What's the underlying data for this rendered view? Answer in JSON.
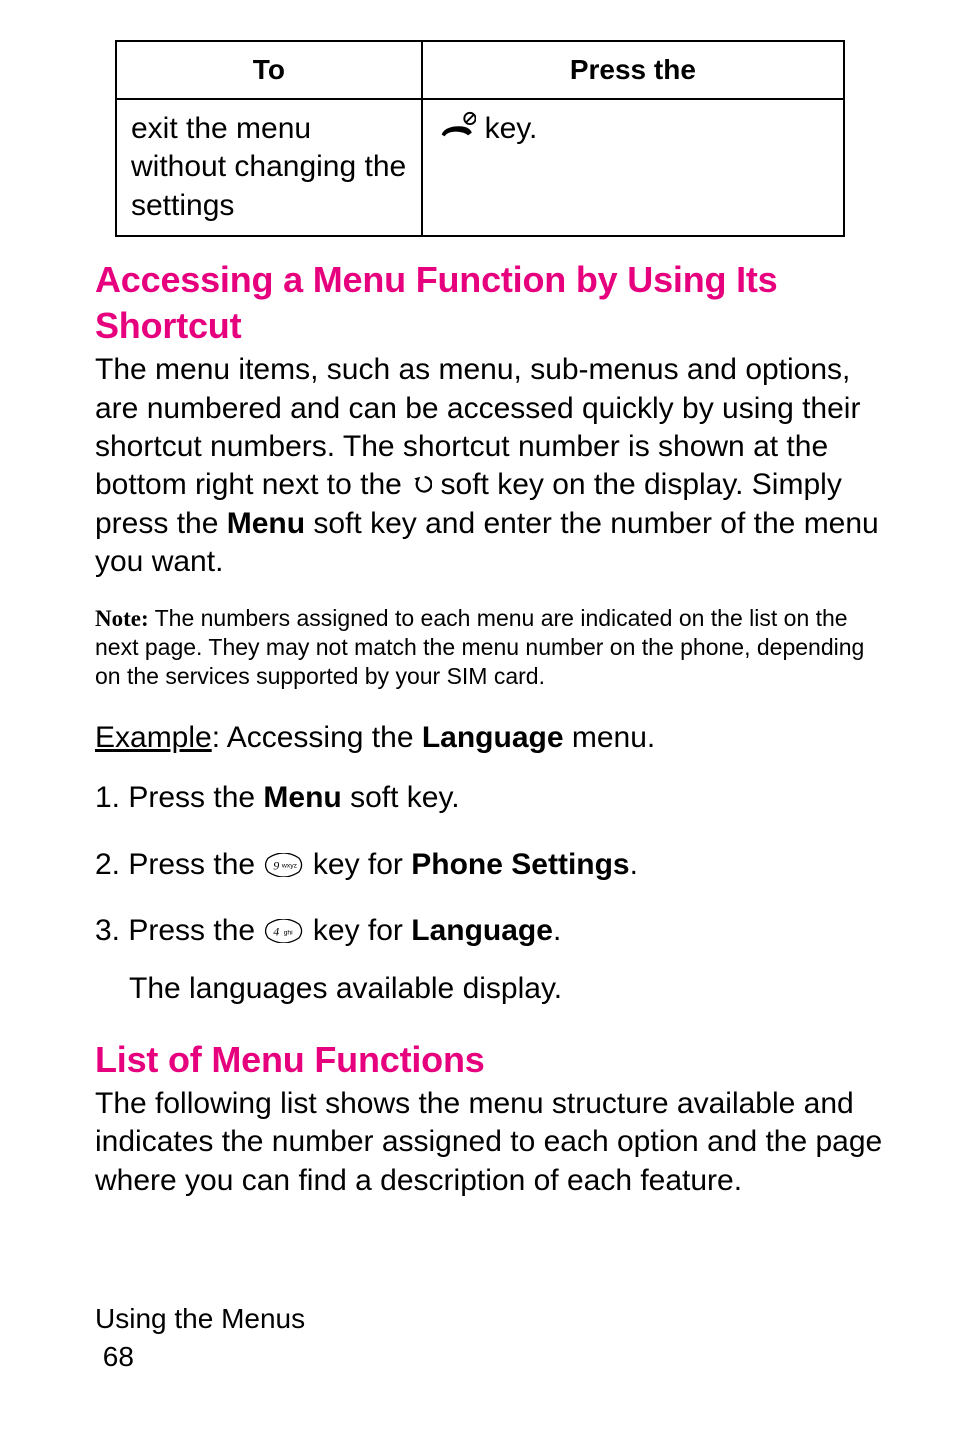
{
  "table": {
    "hdr_to": "To",
    "hdr_press": "Press the",
    "r1c1": "exit the menu without changing the settings",
    "r1c2_after": " key."
  },
  "sec1": {
    "title": "Accessing a Menu Function by Using Its Shortcut",
    "p1a": "The menu items, such as menu, sub-menus and options, are numbered and can be accessed quickly by using their shortcut numbers. The shortcut number is shown at the bottom right next to the ",
    "p1b": " soft key on the display. Simply press the ",
    "p1c": "Menu",
    "p1d": " soft key and enter the number of the menu you want.",
    "note_label": "Note:",
    "note_body": " The numbers assigned to each menu are indicated on the list on the next page. They may not match the menu number on the phone, depending on the services supported by your SIM card.",
    "ex_label": "Example",
    "ex_rest": ": Accessing the ",
    "ex_bold": "Language",
    "ex_end": " menu.",
    "s1a": "1.  Press the ",
    "s1b": "Menu",
    "s1c": " soft key.",
    "s2a": "2.  Press the ",
    "s2b": " key for ",
    "s2c": "Phone Settings",
    "s2d": ".",
    "s3a": "3.  Press the ",
    "s3b": " key for ",
    "s3c": "Language",
    "s3d": ".",
    "s3_body": "The languages available display."
  },
  "sec2": {
    "title": "List of Menu Functions",
    "p1": "The following list shows the menu structure available and indicates the number assigned to each option and the page where you can find a description of each feature."
  },
  "footer": {
    "section": "Using the Menus",
    "page": "68"
  }
}
